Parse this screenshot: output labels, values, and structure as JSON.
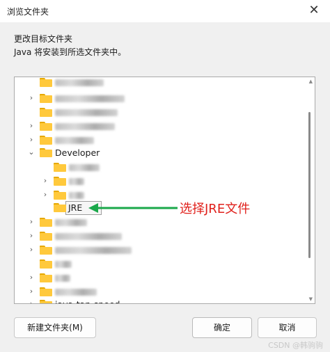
{
  "window": {
    "title": "浏览文件夹",
    "close_glyph": "✕"
  },
  "dialog": {
    "heading": "更改目标文件夹",
    "description": "Java 将安装到所选文件夹中。"
  },
  "tree": {
    "developer_label": "Developer",
    "selected_label": "JRE",
    "partial_label": "java-tan-speed"
  },
  "annotation": {
    "text": "选择JRE文件",
    "color": "#e0201b"
  },
  "buttons": {
    "new_folder": "新建文件夹(M)",
    "ok": "确定",
    "cancel": "取消"
  },
  "watermark": "CSDN @韩驹驹",
  "colors": {
    "folder": "#ffc93c",
    "arrow": "#1aa84a"
  }
}
